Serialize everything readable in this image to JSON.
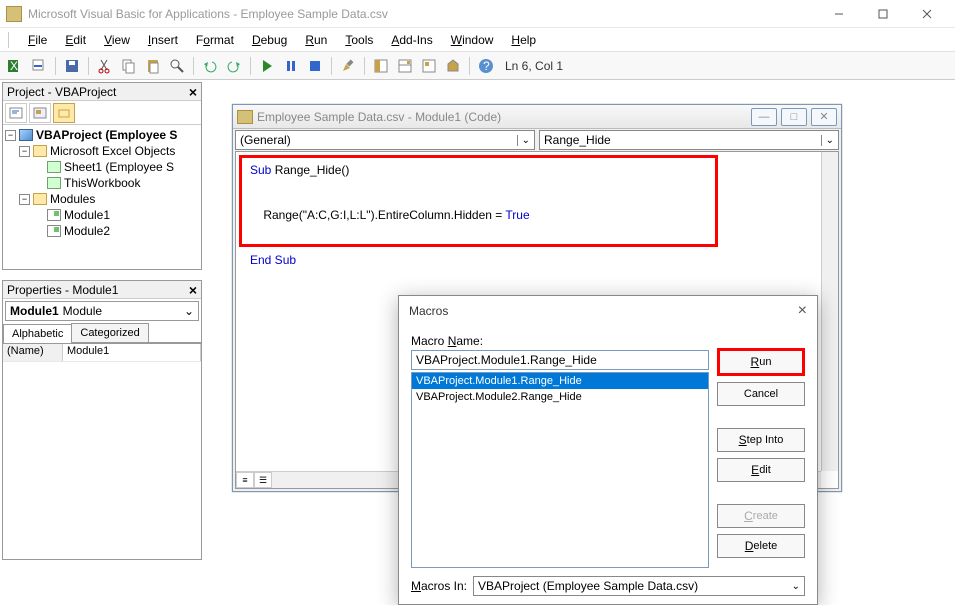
{
  "app": {
    "title": "Microsoft Visual Basic for Applications - Employee Sample Data.csv"
  },
  "menus": [
    "File",
    "Edit",
    "View",
    "Insert",
    "Format",
    "Debug",
    "Run",
    "Tools",
    "Add-Ins",
    "Window",
    "Help"
  ],
  "menu_underlines": [
    "F",
    "E",
    "V",
    "I",
    "o",
    "D",
    "R",
    "T",
    "A",
    "W",
    "H"
  ],
  "toolbar": {
    "location": "Ln 6, Col 1"
  },
  "project_pane": {
    "title": "Project - VBAProject",
    "root": "VBAProject (Employee S",
    "excel_objects": "Microsoft Excel Objects",
    "sheet1": "Sheet1 (Employee S",
    "thisworkbook": "ThisWorkbook",
    "modules_folder": "Modules",
    "module1": "Module1",
    "module2": "Module2"
  },
  "props_pane": {
    "title": "Properties - Module1",
    "object_name": "Module1",
    "object_type": "Module",
    "tab_alpha": "Alphabetic",
    "tab_cat": "Categorized",
    "row_name_label": "(Name)",
    "row_name_value": "Module1"
  },
  "code_window": {
    "title": "Employee Sample Data.csv - Module1 (Code)",
    "dd_left": "(General)",
    "dd_right": "Range_Hide",
    "line1a": "Sub",
    "line1b": " Range_Hide()",
    "line2": "    Range(\"A:C,G:I,L:L\").EntireColumn.Hidden = ",
    "line2b": "True",
    "line3": "End Sub"
  },
  "macros_dialog": {
    "title": "Macros",
    "name_label": "Macro Name:",
    "name_value": "VBAProject.Module1.Range_Hide",
    "list": [
      "VBAProject.Module1.Range_Hide",
      "VBAProject.Module2.Range_Hide"
    ],
    "selected_index": 0,
    "buttons": {
      "run": "Run",
      "cancel": "Cancel",
      "step_into": "Step Into",
      "edit": "Edit",
      "create": "Create",
      "delete": "Delete"
    },
    "macros_in_label": "Macros In:",
    "macros_in_value": "VBAProject (Employee Sample Data.csv)"
  }
}
